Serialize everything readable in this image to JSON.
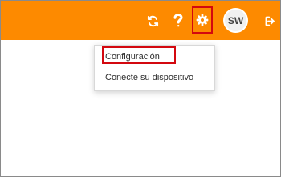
{
  "header": {
    "avatar_initials": "SW",
    "icons": {
      "refresh": "refresh-icon",
      "help": "help-icon",
      "settings": "gear-icon",
      "logout": "logout-icon"
    },
    "colors": {
      "bar": "#fd8a00",
      "highlight": "#d3080f",
      "icon": "#ffffff"
    }
  },
  "settings_menu": {
    "items": [
      {
        "label": "Configuración"
      },
      {
        "label": "Conecte su dispositivo"
      }
    ]
  }
}
